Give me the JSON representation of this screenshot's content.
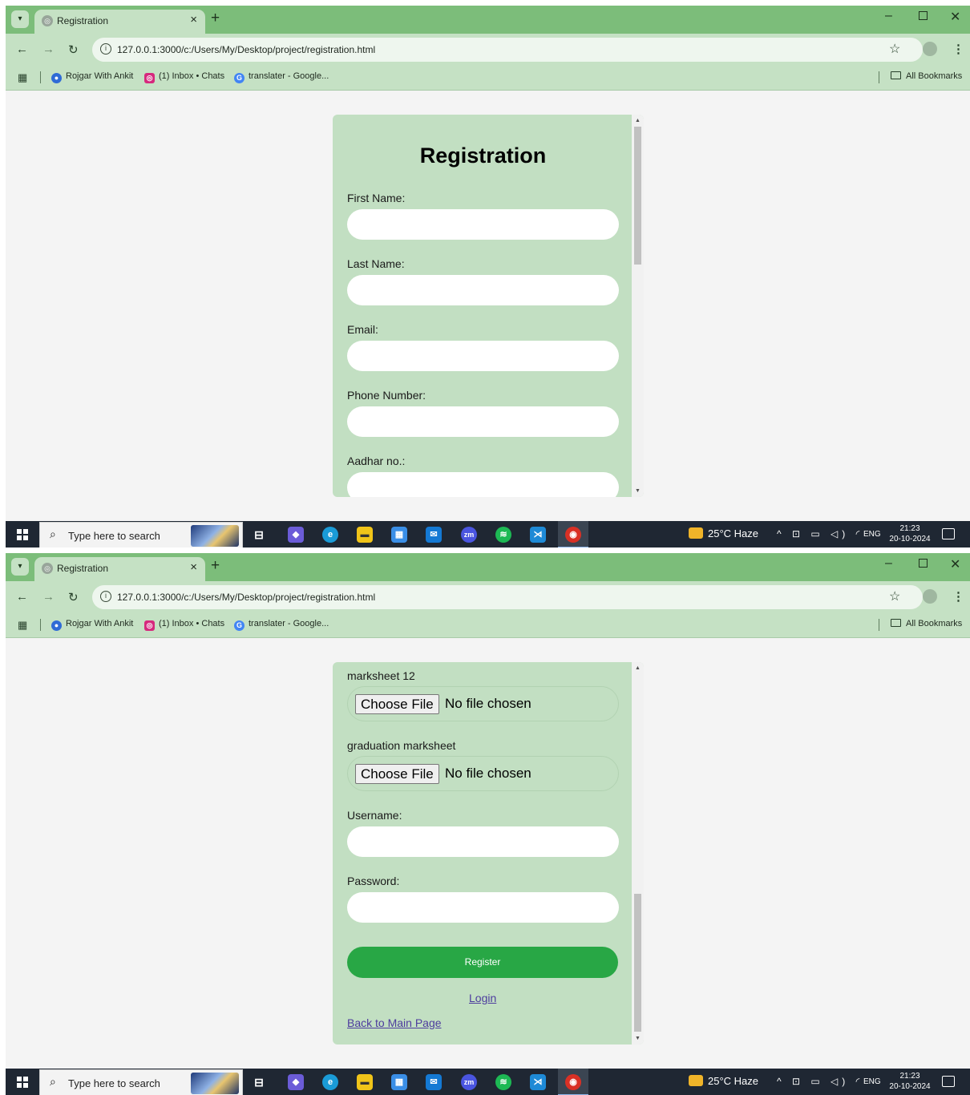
{
  "browser": {
    "tab_title": "Registration",
    "tab_close": "×",
    "new_tab": "+",
    "url": "127.0.0.1:3000/c:/Users/My/Desktop/project/registration.html",
    "bookmarks": [
      "Rojgar With Ankit",
      "(1) Inbox • Chats",
      "translater - Google..."
    ],
    "all_bookmarks": "All Bookmarks",
    "icons": [
      "chevron-down-icon",
      "back-arrow-icon",
      "forward-arrow-icon",
      "reload-icon",
      "info-icon",
      "star-icon",
      "profile-icon",
      "kebab-menu-icon",
      "apps-grid-icon",
      "folder-icon"
    ]
  },
  "form": {
    "title": "Registration",
    "first_name_label": "First Name:",
    "last_name_label": "Last Name:",
    "email_label": "Email:",
    "phone_label": "Phone Number:",
    "aadhar_label": "Aadhar no.:",
    "marksheet12_label": "marksheet 12",
    "graduation_label": "graduation marksheet",
    "file_button": "Choose File",
    "file_status": "No file chosen",
    "username_label": "Username:",
    "password_label": "Password:",
    "register_button": "Register",
    "login_link": "Login",
    "back_link": "Back to Main Page",
    "accent_color": "#28a745",
    "card_color": "#c2dfc2"
  },
  "taskbar": {
    "search_placeholder": "Type here to search",
    "weather": "25°C  Haze",
    "language": "ENG",
    "time": "21:23",
    "date": "20-10-2024",
    "apps": [
      "task-view-icon",
      "copilot-icon",
      "edge-icon",
      "file-explorer-icon",
      "store-icon",
      "mail-icon",
      "zoom-icon",
      "spotify-icon",
      "vscode-icon",
      "chrome-icon"
    ]
  }
}
